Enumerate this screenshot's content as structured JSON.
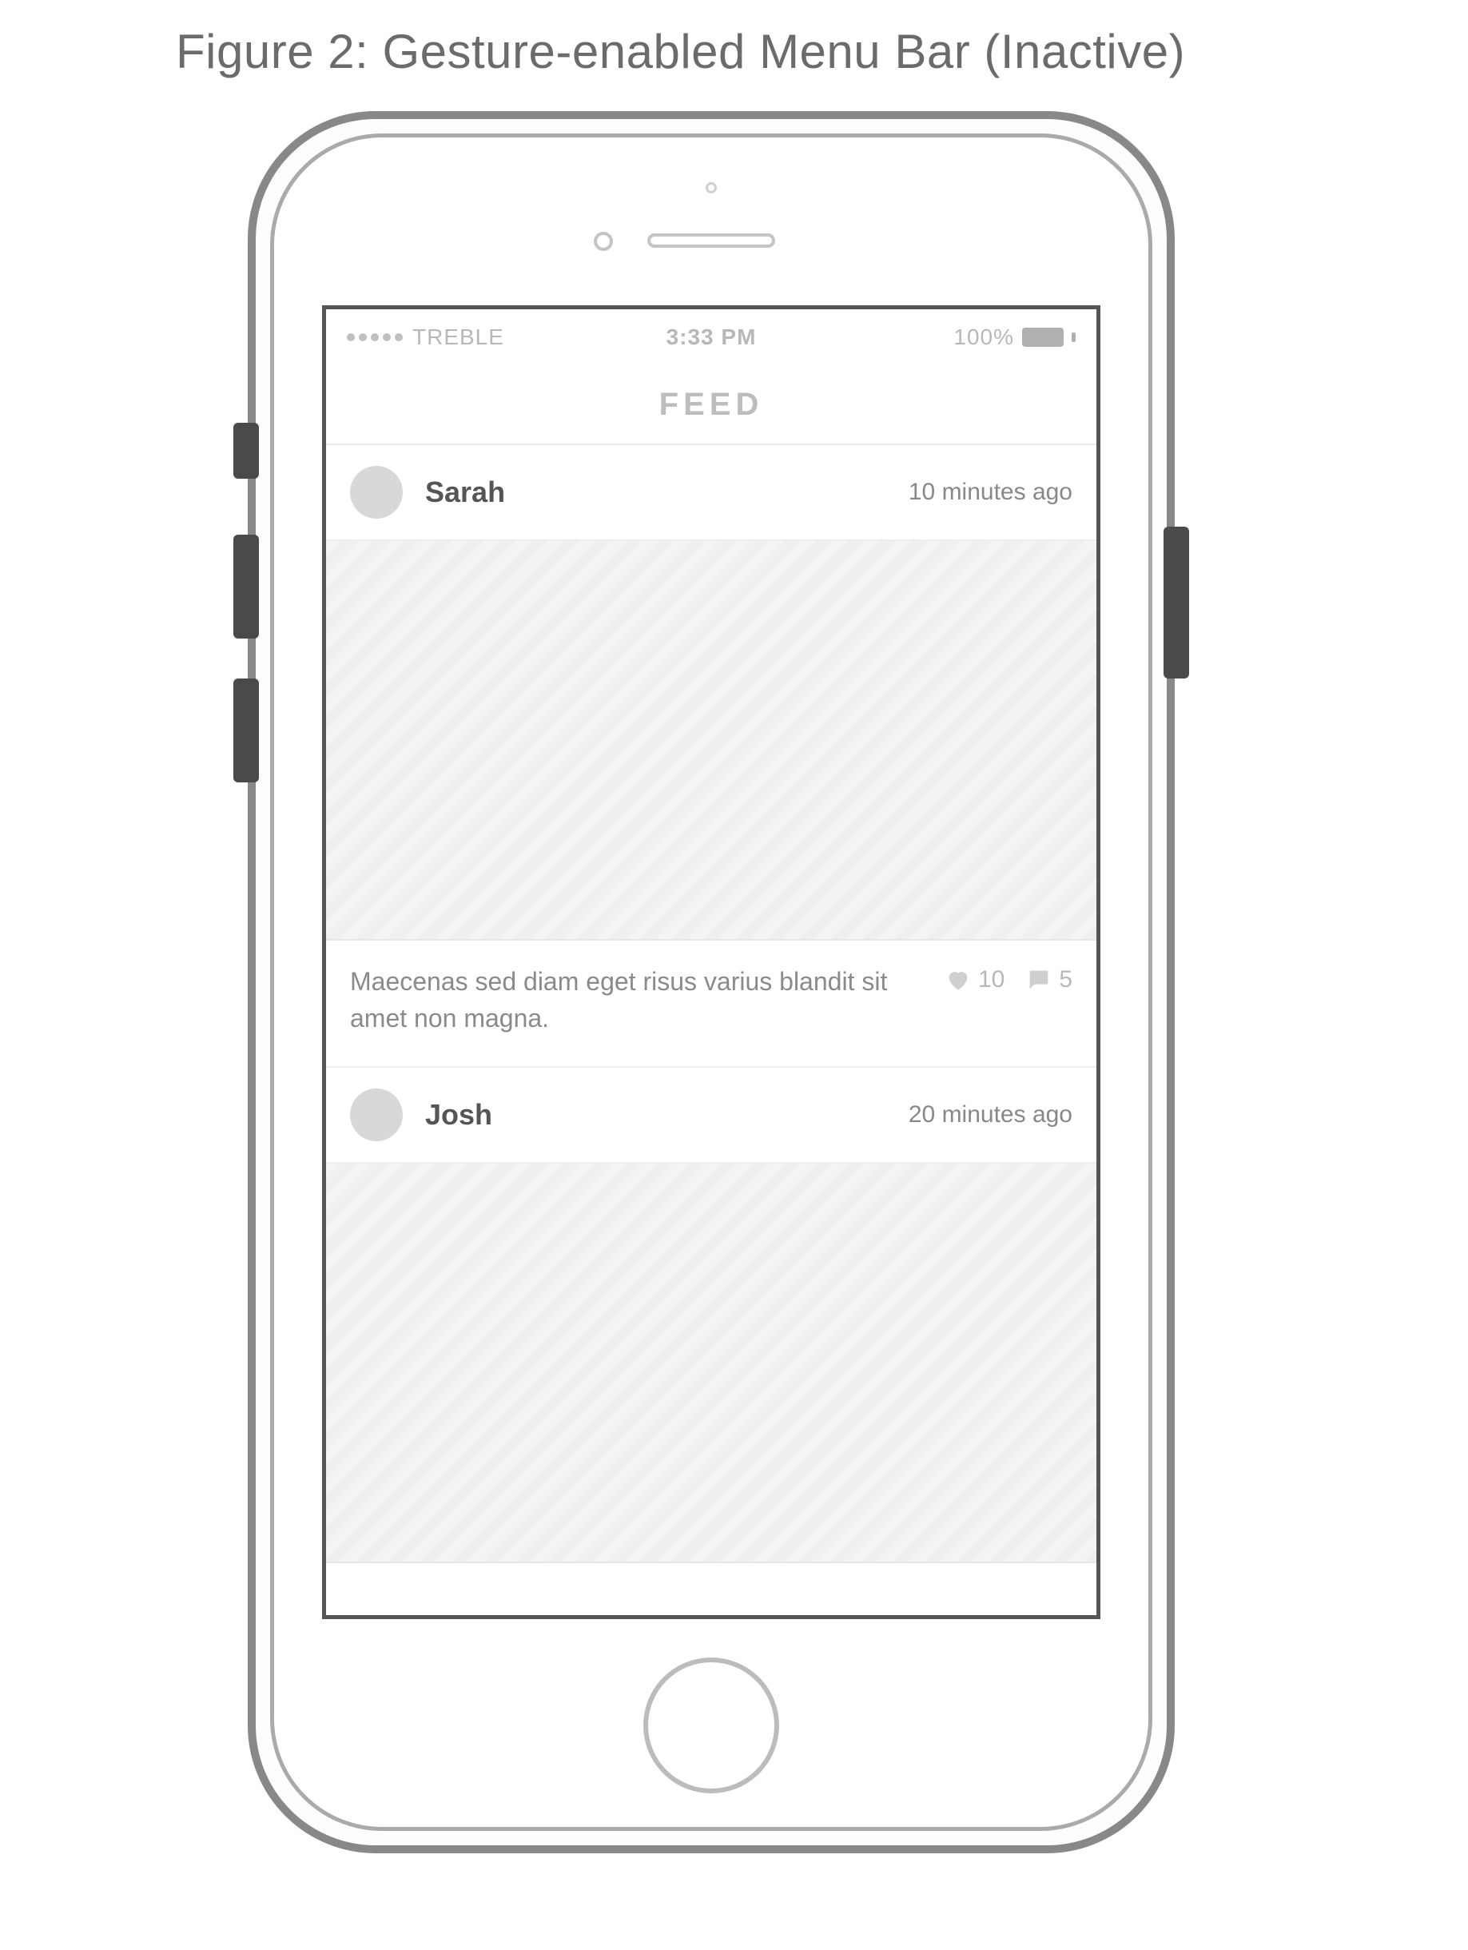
{
  "figure_caption": "Figure 2: Gesture-enabled Menu Bar (Inactive)",
  "status": {
    "carrier": "TREBLE",
    "time": "3:33 PM",
    "battery_text": "100%"
  },
  "nav": {
    "title": "FEED"
  },
  "feed": [
    {
      "author": "Sarah",
      "time_ago": "10 minutes ago",
      "caption": "Maecenas sed diam eget risus varius blandit sit amet non magna.",
      "likes": "10",
      "comments": "5"
    },
    {
      "author": "Josh",
      "time_ago": "20 minutes ago",
      "caption": "",
      "likes": "",
      "comments": ""
    }
  ]
}
